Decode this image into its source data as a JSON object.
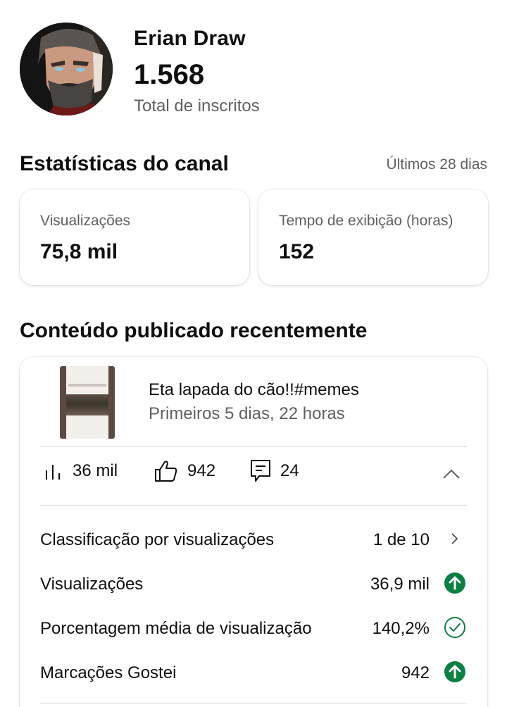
{
  "channel": {
    "name": "Erian Draw",
    "subscribers": "1.568",
    "subscribers_label": "Total de inscritos"
  },
  "stats": {
    "title": "Estatísticas do canal",
    "period": "Últimos 28 dias",
    "cards": [
      {
        "label": "Visualizações",
        "value": "75,8 mil"
      },
      {
        "label": "Tempo de exibição (horas)",
        "value": "152"
      }
    ]
  },
  "recent": {
    "title": "Conteúdo publicado recentemente",
    "video": {
      "title": "Eta lapada do cão!!#memes",
      "meta": "Primeiros 5 dias, 22 horas",
      "views": "36 mil",
      "likes": "942",
      "comments": "24"
    },
    "rows": [
      {
        "label": "Classificação por visualizações",
        "value": "1 de 10",
        "icon": "chevron-right-icon"
      },
      {
        "label": "Visualizações",
        "value": "36,9 mil",
        "icon": "arrow-up-circle-icon"
      },
      {
        "label": "Porcentagem média de visualização",
        "value": "140,2%",
        "icon": "check-circle-icon"
      },
      {
        "label": "Marcações Gostei",
        "value": "942",
        "icon": "arrow-up-circle-icon"
      }
    ]
  },
  "colors": {
    "positive": "#0b8043",
    "secondary_text": "#606060",
    "divider": "#d9d9d9"
  }
}
